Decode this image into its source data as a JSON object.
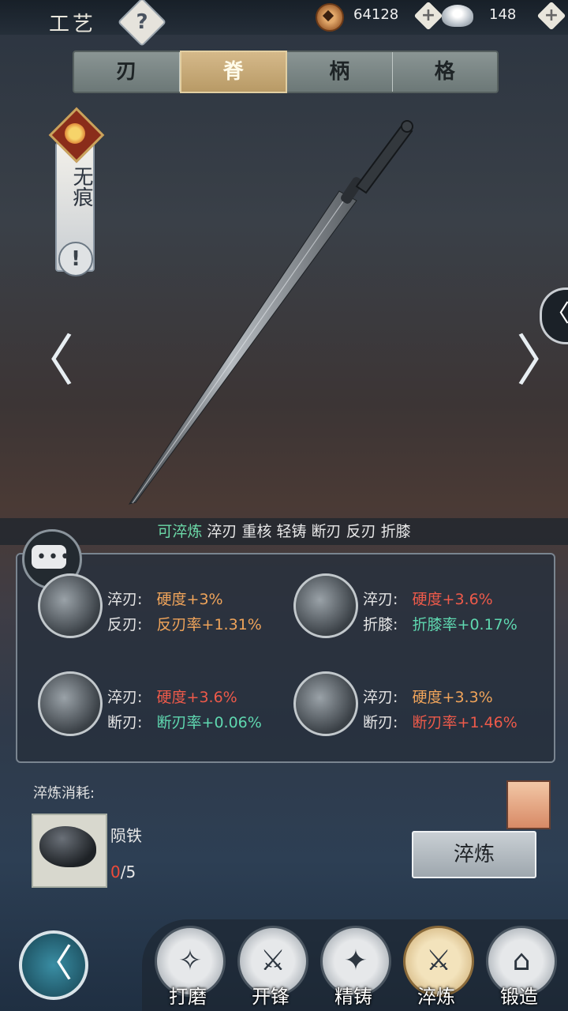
{
  "header": {
    "title": "工艺",
    "help_icon": "?",
    "copper_amount": "64128",
    "silver_amount": "148",
    "plus": "+"
  },
  "tabs": [
    {
      "label": "刃",
      "active": false
    },
    {
      "label": "脊",
      "active": true
    },
    {
      "label": "柄",
      "active": false
    },
    {
      "label": "格",
      "active": false
    }
  ],
  "badge": {
    "name": "无痕",
    "alert": "!"
  },
  "nav_arrows": {
    "left": "〈",
    "right": "〉",
    "side": "〈"
  },
  "attributes": {
    "highlight": "可淬炼",
    "list": "淬刃 重核 轻铸 断刃 反刃 折膝"
  },
  "options": [
    {
      "k1": "淬刃:",
      "v1": "硬度+3%",
      "k2": "反刃:",
      "v2": "反刃率+1.31%",
      "c1": "orange",
      "c2": "orange"
    },
    {
      "k1": "淬刃:",
      "v1": "硬度+3.6%",
      "k2": "折膝:",
      "v2": "折膝率+0.17%",
      "c1": "red",
      "c2": "green"
    },
    {
      "k1": "淬刃:",
      "v1": "硬度+3.6%",
      "k2": "断刃:",
      "v2": "断刃率+0.06%",
      "c1": "red",
      "c2": "green"
    },
    {
      "k1": "淬刃:",
      "v1": "硬度+3.3%",
      "k2": "断刃:",
      "v2": "断刃率+1.46%",
      "c1": "orange",
      "c2": "red"
    }
  ],
  "cost": {
    "label": "淬炼消耗:",
    "material": "陨铁",
    "have": "0",
    "need": "/5",
    "button": "淬炼"
  },
  "bottom_nav": [
    {
      "label": "打磨",
      "icon": "✧",
      "active": false
    },
    {
      "label": "开锋",
      "icon": "⚔",
      "active": false
    },
    {
      "label": "精铸",
      "icon": "✦",
      "active": false
    },
    {
      "label": "淬炼",
      "icon": "⚔",
      "active": true
    },
    {
      "label": "锻造",
      "icon": "⌂",
      "active": false
    }
  ],
  "back": "〈"
}
